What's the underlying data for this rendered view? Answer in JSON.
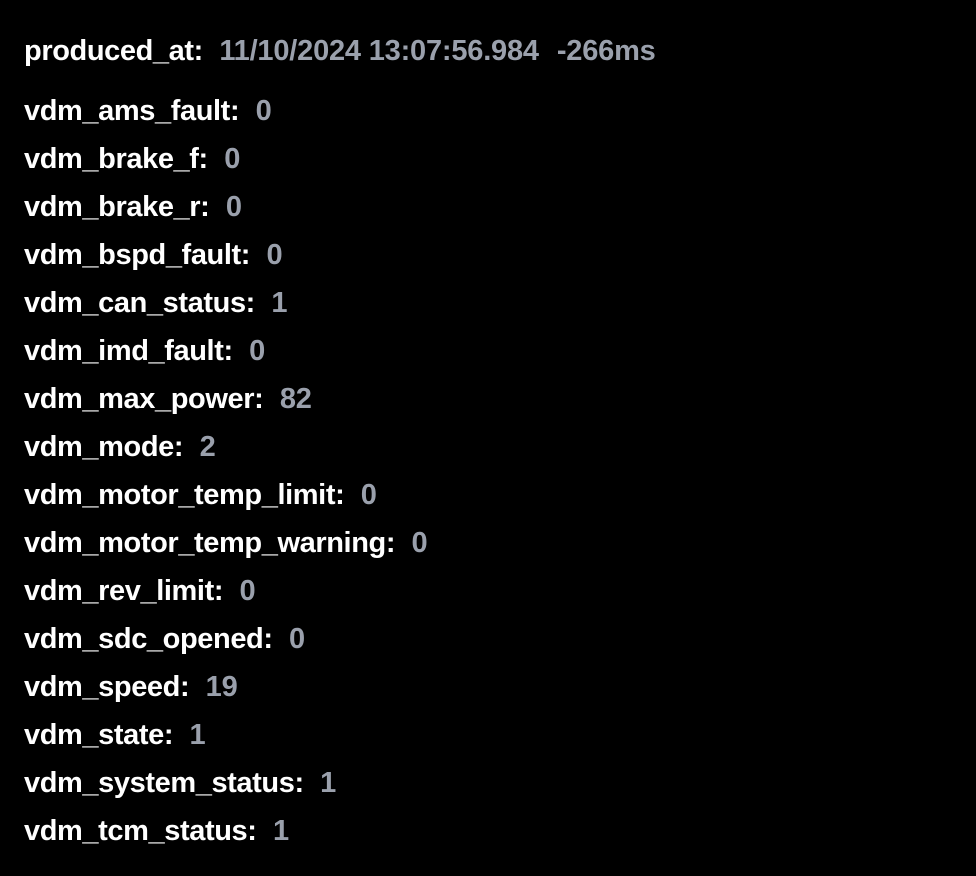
{
  "header": {
    "key": "produced_at",
    "timestamp": "11/10/2024 13:07:56.984",
    "offset": "-266ms"
  },
  "fields": [
    {
      "key": "vdm_ams_fault",
      "value": "0"
    },
    {
      "key": "vdm_brake_f",
      "value": "0"
    },
    {
      "key": "vdm_brake_r",
      "value": "0"
    },
    {
      "key": "vdm_bspd_fault",
      "value": "0"
    },
    {
      "key": "vdm_can_status",
      "value": "1"
    },
    {
      "key": "vdm_imd_fault",
      "value": "0"
    },
    {
      "key": "vdm_max_power",
      "value": "82"
    },
    {
      "key": "vdm_mode",
      "value": "2"
    },
    {
      "key": "vdm_motor_temp_limit",
      "value": "0"
    },
    {
      "key": "vdm_motor_temp_warning",
      "value": "0"
    },
    {
      "key": "vdm_rev_limit",
      "value": "0"
    },
    {
      "key": "vdm_sdc_opened",
      "value": "0"
    },
    {
      "key": "vdm_speed",
      "value": "19"
    },
    {
      "key": "vdm_state",
      "value": "1"
    },
    {
      "key": "vdm_system_status",
      "value": "1"
    },
    {
      "key": "vdm_tcm_status",
      "value": "1"
    }
  ]
}
